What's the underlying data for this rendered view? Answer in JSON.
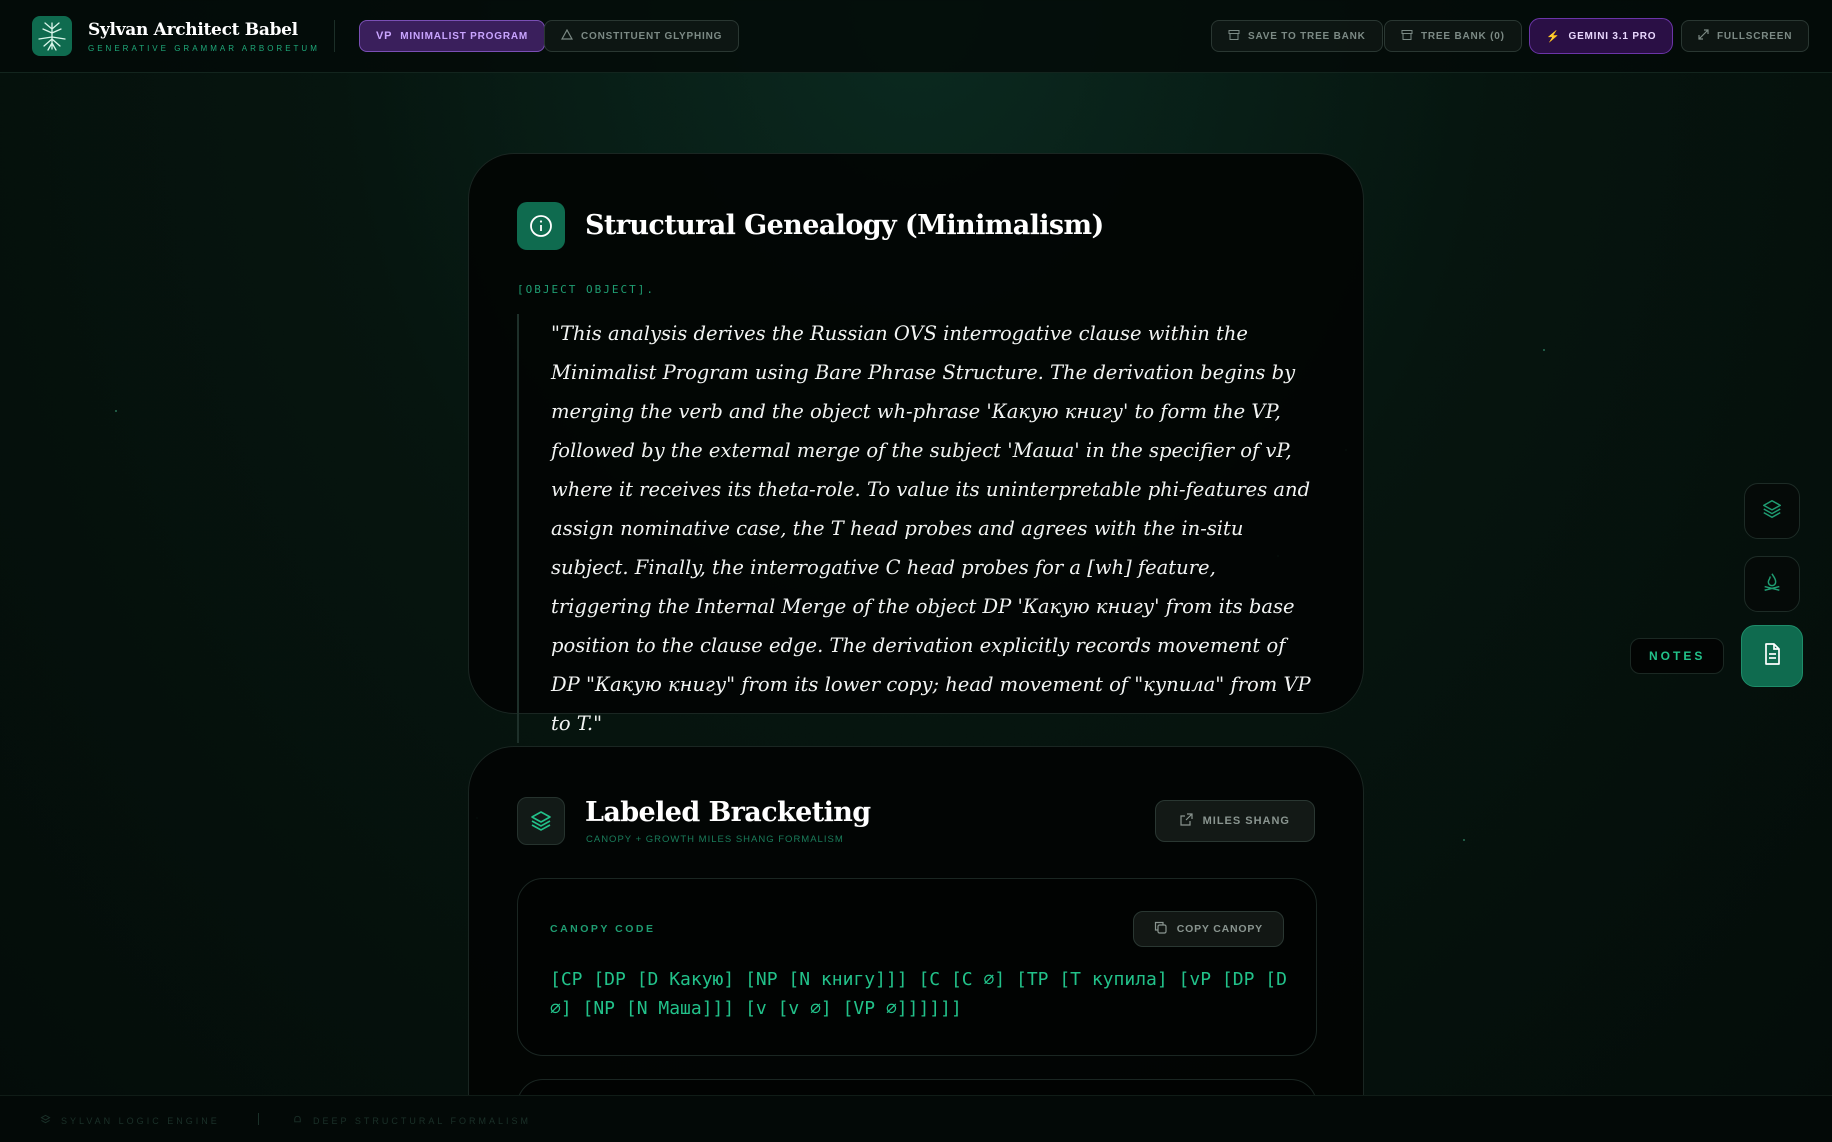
{
  "header": {
    "brand_title": "Sylvan Architect Babel",
    "brand_subtitle": "Generative Grammar Arboretum",
    "tabs": [
      {
        "icon_text": "vP",
        "label": "Minimalist Program",
        "active": true
      },
      {
        "icon": "triangle-icon",
        "label": "Constituent Glyphing",
        "active": false
      }
    ],
    "actions": {
      "save": "Save to Tree Bank",
      "bank": "Tree Bank (0)",
      "model": "Gemini 3.1 Pro",
      "fullscreen": "Fullscreen"
    }
  },
  "genealogy": {
    "title": "Structural Genealogy (Minimalism)",
    "object_label": "[OBJECT OBJECT].",
    "quote": "\"This analysis derives the Russian OVS interrogative clause within the Minimalist Program using Bare Phrase Structure. The derivation begins by merging the verb and the object wh-phrase 'Какую книгу' to form the VP, followed by the external merge of the subject 'Маша' in the specifier of vP, where it receives its theta-role. To value its uninterpretable phi-features and assign nominative case, the T head probes and agrees with the in-situ subject. Finally, the interrogative C head probes for a [wh] feature, triggering the Internal Merge of the object DP 'Какую книгу' from its base position to the clause edge. The derivation explicitly records movement of DP \"Какую книгу\" from its lower copy; head movement of \"купила\" from VP to T.\""
  },
  "bracketing": {
    "title": "Labeled Bracketing",
    "subtitle": "Canopy + Growth Miles Shang Formalism",
    "miles_button": "Miles Shang",
    "code_label": "CANOPY CODE",
    "copy_button": "Copy Canopy",
    "code": "[CP [DP [D Какую] [NP [N книгу]]] [C [C ∅] [TP [T купила] [vP [DP [D ∅] [NP [N Маша]]] [v [v ∅] [VP ∅]]]]]]"
  },
  "rail": {
    "notes_tooltip": "NOTES",
    "buttons": [
      "layers-icon",
      "campfire-icon",
      "notes-icon"
    ]
  },
  "footer": {
    "left": "Sylvan Logic Engine",
    "right": "Deep Structural Formalism"
  },
  "colors": {
    "accent": "#22c28a",
    "brand_green": "#0f6b4f",
    "purple": "#7a4fb5"
  }
}
